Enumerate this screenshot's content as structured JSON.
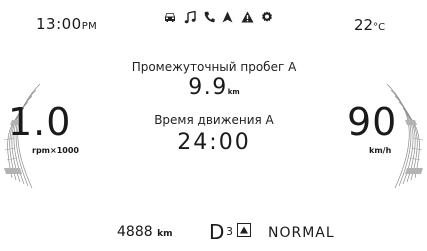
{
  "status_bar": {
    "time": "13:00",
    "time_suffix": "PM",
    "temperature": "22",
    "temperature_unit": "°C",
    "icons": [
      "car-icon",
      "music-note-icon",
      "phone-icon",
      "navigation-arrow-icon",
      "warning-triangle-icon",
      "settings-gear-icon"
    ]
  },
  "tachometer": {
    "value": "1.0",
    "unit": "rpm×1000"
  },
  "speedometer": {
    "value": "90",
    "unit": "km/h"
  },
  "trip": {
    "distance_label": "Промежуточный пробег А",
    "distance_value": "9.9",
    "distance_unit": "km",
    "time_label": "Время движения А",
    "time_value": "24:00"
  },
  "bottom_bar": {
    "odometer": "4888",
    "odometer_unit": "km",
    "gear": "D",
    "gear_sub": "3",
    "drive_mode": "NORMAL"
  },
  "colors": {
    "text": "#1a1a1a",
    "gauge_stroke": "#8c8c8c",
    "background": "#ffffff"
  }
}
